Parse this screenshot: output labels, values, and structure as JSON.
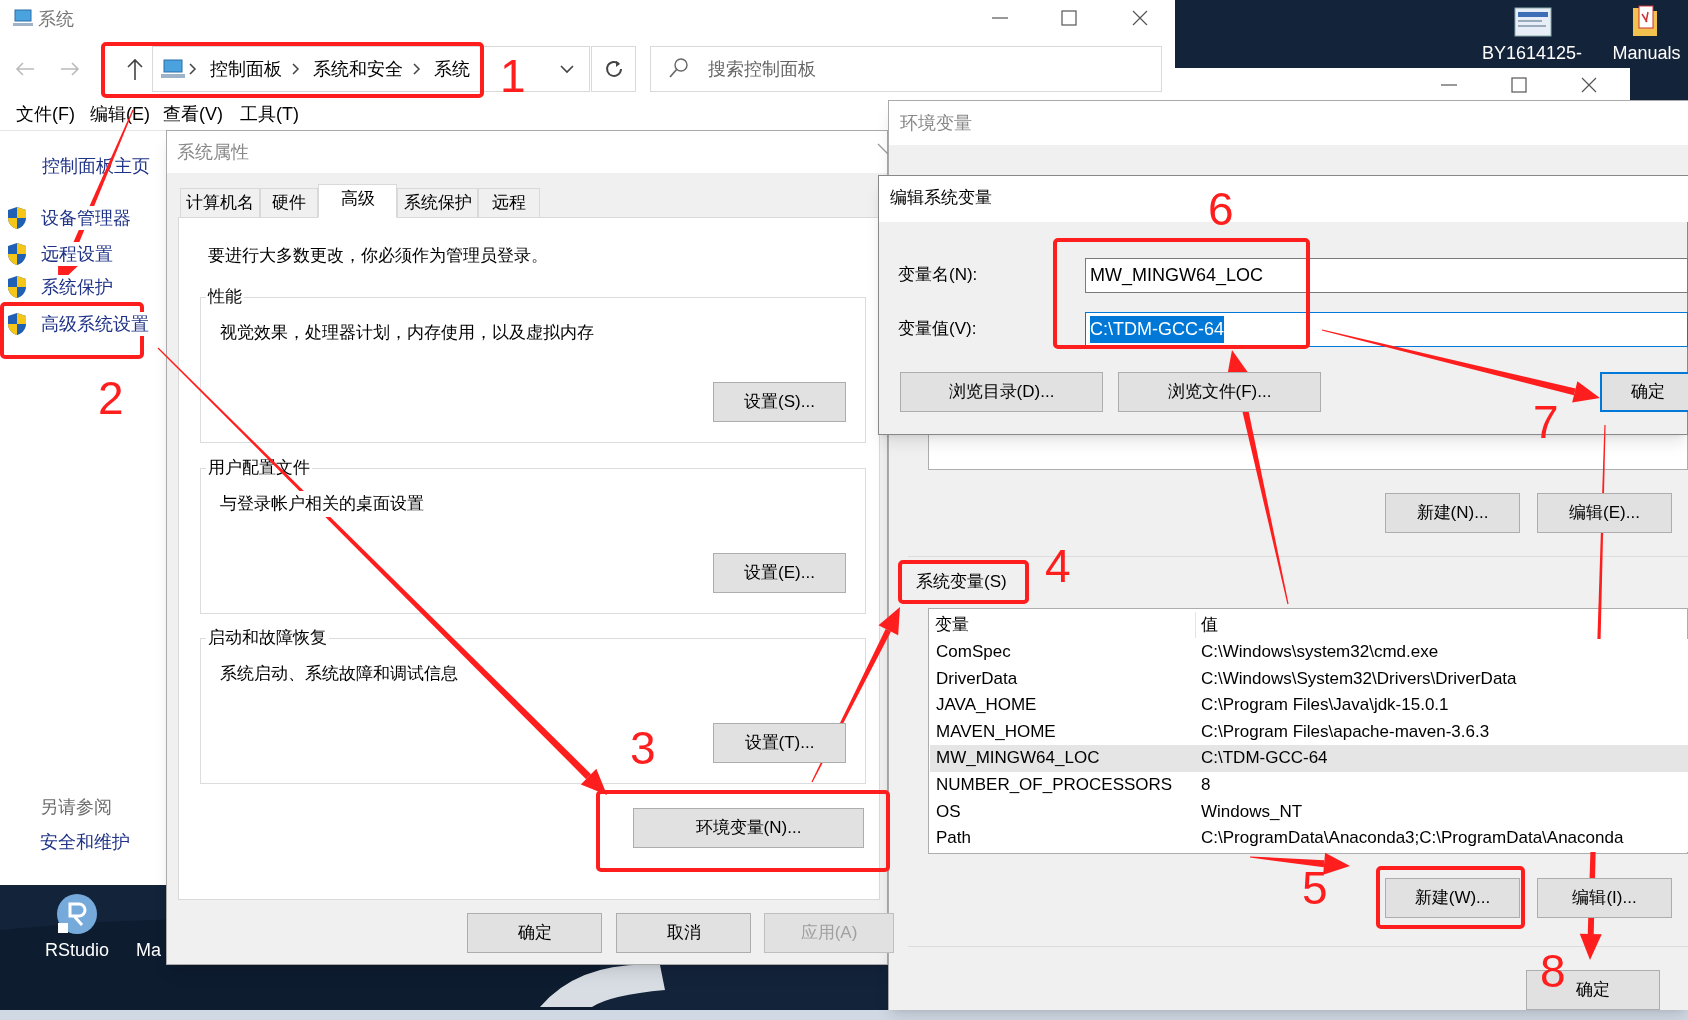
{
  "desktop": {
    "icons": [
      {
        "label": "BY1614125-"
      },
      {
        "label": "Manuals"
      },
      {
        "label": "RStudio"
      },
      {
        "label": "Ma"
      }
    ]
  },
  "system_window": {
    "title": "系统",
    "breadcrumb": [
      "控制面板",
      "系统和安全",
      "系统"
    ],
    "search": {
      "placeholder": "搜索控制面板"
    },
    "menu": [
      "文件(F)",
      "编辑(E)",
      "查看(V)",
      "工具(T)"
    ],
    "sidebar": {
      "home": "控制面板主页",
      "items": [
        "设备管理器",
        "远程设置",
        "系统保护",
        "高级系统设置"
      ],
      "see_also": "另请参阅",
      "links": [
        "安全和维护"
      ]
    }
  },
  "system_properties": {
    "title": "系统属性",
    "tabs": [
      {
        "label": "计算机名",
        "selected": false
      },
      {
        "label": "硬件",
        "selected": false
      },
      {
        "label": "高级",
        "selected": true
      },
      {
        "label": "系统保护",
        "selected": false
      },
      {
        "label": "远程",
        "selected": false
      }
    ],
    "note": "要进行大多数更改，你必须作为管理员登录。",
    "groups": [
      {
        "title": "性能",
        "description": "视觉效果，处理器计划，内存使用，以及虚拟内存",
        "button": "设置(S)..."
      },
      {
        "title": "用户配置文件",
        "description": "与登录帐户相关的桌面设置",
        "button": "设置(E)..."
      },
      {
        "title": "启动和故障恢复",
        "description": "系统启动、系统故障和调试信息",
        "button": "设置(T)..."
      }
    ],
    "env_button": "环境变量(N)...",
    "buttons": [
      {
        "label": "确定",
        "disabled": false
      },
      {
        "label": "取消",
        "disabled": false
      },
      {
        "label": "应用(A)",
        "disabled": true
      }
    ]
  },
  "environment_variables": {
    "title": "环境变量",
    "user_buttons": [
      "新建(N)...",
      "编辑(E)..."
    ],
    "system_section": {
      "label": "系统变量(S)",
      "columns": [
        "变量",
        "值"
      ],
      "rows": [
        {
          "name": "ComSpec",
          "value": "C:\\Windows\\system32\\cmd.exe",
          "selected": false
        },
        {
          "name": "DriverData",
          "value": "C:\\Windows\\System32\\Drivers\\DriverData",
          "selected": false
        },
        {
          "name": "JAVA_HOME",
          "value": "C:\\Program Files\\Java\\jdk-15.0.1",
          "selected": false
        },
        {
          "name": "MAVEN_HOME",
          "value": "C:\\Program Files\\apache-maven-3.6.3",
          "selected": false
        },
        {
          "name": "MW_MINGW64_LOC",
          "value": "C:\\TDM-GCC-64",
          "selected": true
        },
        {
          "name": "NUMBER_OF_PROCESSORS",
          "value": "8",
          "selected": false
        },
        {
          "name": "OS",
          "value": "Windows_NT",
          "selected": false
        },
        {
          "name": "Path",
          "value": "C:\\ProgramData\\Anaconda3;C:\\ProgramData\\Anaconda",
          "selected": false
        }
      ],
      "buttons": [
        "新建(W)...",
        "编辑(I)..."
      ]
    },
    "buttons": [
      "确定"
    ]
  },
  "edit_dialog": {
    "title": "编辑系统变量",
    "fields": [
      {
        "label": "变量名(N):",
        "value": "MW_MINGW64_LOC",
        "focused": false
      },
      {
        "label": "变量值(V):",
        "value": "C:\\TDM-GCC-64",
        "focused": true
      }
    ],
    "buttons": [
      {
        "label": "浏览目录(D)...",
        "default": false
      },
      {
        "label": "浏览文件(F)...",
        "default": false
      },
      {
        "label": "确定",
        "default": true
      }
    ]
  },
  "annotations": [
    "1",
    "2",
    "3",
    "4",
    "5",
    "6",
    "7",
    "8"
  ]
}
